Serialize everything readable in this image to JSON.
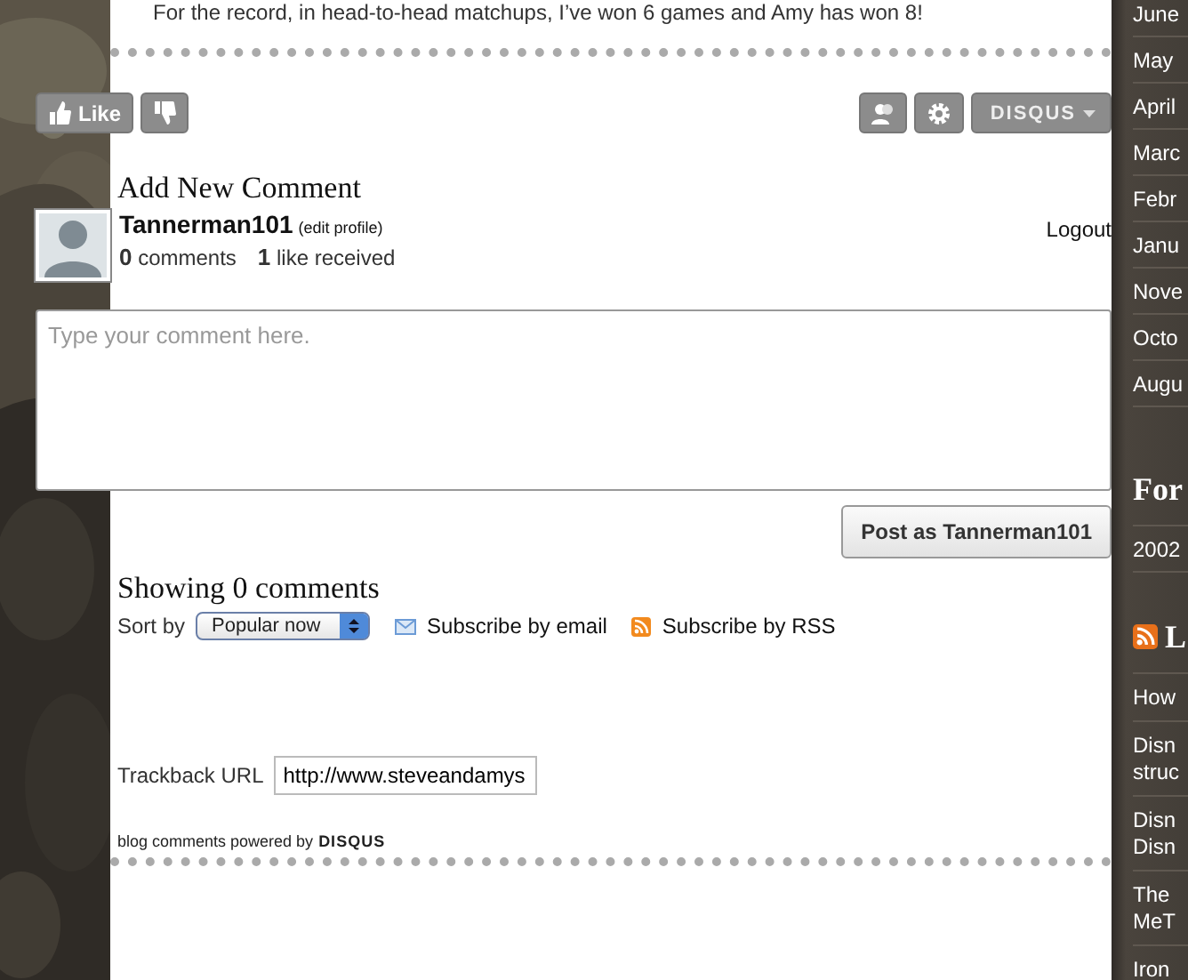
{
  "post_text": "For the record, in head-to-head matchups, I’ve won 6 games and Amy has won 8!",
  "toolbar": {
    "like_label": "Like",
    "brand": "DISQUS"
  },
  "comment_form": {
    "heading": "Add New Comment",
    "username": "Tannerman101",
    "edit_link": "(edit profile)",
    "comments_count": "0",
    "comments_label": "comments",
    "likes_count": "1",
    "likes_label": "like received",
    "logout": "Logout",
    "placeholder": "Type your comment here.",
    "post_button": "Post as Tannerman101"
  },
  "comments": {
    "heading": "Showing 0 comments",
    "sort_label": "Sort by",
    "sort_value": "Popular now",
    "subscribe_links": [
      {
        "kind": "email",
        "label": "Subscribe by email"
      },
      {
        "kind": "rss",
        "label": "Subscribe by RSS"
      }
    ]
  },
  "trackback": {
    "label": "Trackback URL",
    "value": "http://www.steveandamys"
  },
  "footer": {
    "text": "blog comments powered by",
    "brand": "DISQUS"
  },
  "sidebar": {
    "archive": [
      "June",
      "May",
      "April",
      "Marc",
      "Febr",
      "Janu",
      "Nove",
      "Octo",
      "Augu"
    ],
    "heading_2": "For",
    "section_2_items": [
      "2002"
    ],
    "heading_3": "L",
    "latest": [
      [
        "How"
      ],
      [
        "Disn",
        "struc"
      ],
      [
        "Disn",
        "Disn"
      ],
      [
        "The",
        "MeT"
      ],
      [
        "Iron"
      ]
    ]
  }
}
